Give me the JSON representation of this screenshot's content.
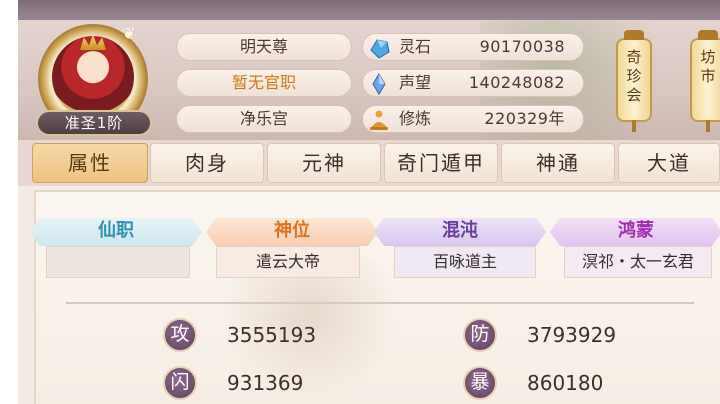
{
  "profile": {
    "rank": "准圣1阶",
    "name": "明天尊",
    "official_title": "暂无官职",
    "sect": "净乐宫"
  },
  "resources": [
    {
      "label": "灵石",
      "value": "90170038",
      "icon": "spirit-stone-icon"
    },
    {
      "label": "声望",
      "value": "140248082",
      "icon": "reputation-crystal-icon"
    },
    {
      "label": "修炼",
      "value": "220329年",
      "icon": "meditation-icon"
    }
  ],
  "side_buttons": [
    {
      "label": "奇珍会"
    },
    {
      "label": "坊市"
    }
  ],
  "tabs": [
    {
      "label": "属性",
      "active": true
    },
    {
      "label": "肉身",
      "active": false
    },
    {
      "label": "元神",
      "active": false
    },
    {
      "label": "奇门遁甲",
      "active": false
    },
    {
      "label": "神通",
      "active": false
    },
    {
      "label": "大道",
      "active": false
    }
  ],
  "titles": [
    {
      "heading": "仙职",
      "value": "",
      "color": "#2f8fb6"
    },
    {
      "heading": "神位",
      "value": "遣云大帝",
      "color": "#e0741f"
    },
    {
      "heading": "混沌",
      "value": "百咏道主",
      "color": "#6a3e9c"
    },
    {
      "heading": "鸿蒙",
      "value": "溟祁・太一玄君",
      "color": "#a12fb2"
    }
  ],
  "attributes": [
    {
      "label": "攻",
      "value": "3555193"
    },
    {
      "label": "防",
      "value": "3793929"
    },
    {
      "label": "闪",
      "value": "931369"
    },
    {
      "label": "暴",
      "value": "860180"
    }
  ]
}
